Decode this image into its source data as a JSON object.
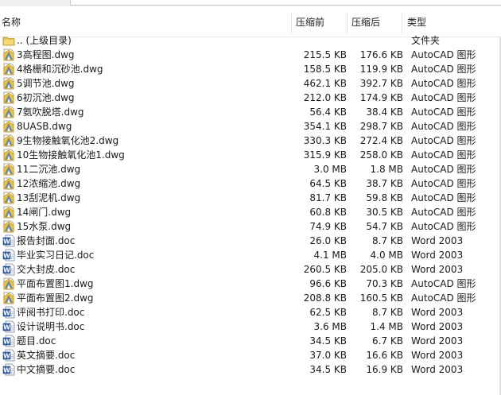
{
  "columns": {
    "name": "名称",
    "packed": "压缩前",
    "compressed": "压缩后",
    "type": "类型"
  },
  "files": [
    {
      "name": ".. (上级目录)",
      "packed": "",
      "compressed": "",
      "type": "文件夹",
      "icon": "folder-icon"
    },
    {
      "name": "3高程图.dwg",
      "packed": "215.5 KB",
      "compressed": "176.6 KB",
      "type": "AutoCAD 图形",
      "icon": "dwg-file-icon"
    },
    {
      "name": "4格栅和沉砂池.dwg",
      "packed": "158.5 KB",
      "compressed": "119.9 KB",
      "type": "AutoCAD 图形",
      "icon": "dwg-file-icon"
    },
    {
      "name": "5调节池.dwg",
      "packed": "462.1 KB",
      "compressed": "392.7 KB",
      "type": "AutoCAD 图形",
      "icon": "dwg-file-icon"
    },
    {
      "name": "6初沉池.dwg",
      "packed": "212.0 KB",
      "compressed": "174.9 KB",
      "type": "AutoCAD 图形",
      "icon": "dwg-file-icon"
    },
    {
      "name": "7氨吹脱塔.dwg",
      "packed": "56.4 KB",
      "compressed": "38.4 KB",
      "type": "AutoCAD 图形",
      "icon": "dwg-file-icon"
    },
    {
      "name": "8UASB.dwg",
      "packed": "354.1 KB",
      "compressed": "298.7 KB",
      "type": "AutoCAD 图形",
      "icon": "dwg-file-icon"
    },
    {
      "name": "9生物接触氧化池2.dwg",
      "packed": "330.3 KB",
      "compressed": "272.4 KB",
      "type": "AutoCAD 图形",
      "icon": "dwg-file-icon"
    },
    {
      "name": "10生物接触氧化池1.dwg",
      "packed": "315.9 KB",
      "compressed": "258.0 KB",
      "type": "AutoCAD 图形",
      "icon": "dwg-file-icon"
    },
    {
      "name": "11二沉池.dwg",
      "packed": "3.0 MB",
      "compressed": "1.8 MB",
      "type": "AutoCAD 图形",
      "icon": "dwg-file-icon"
    },
    {
      "name": "12浓缩池.dwg",
      "packed": "64.5 KB",
      "compressed": "38.7 KB",
      "type": "AutoCAD 图形",
      "icon": "dwg-file-icon"
    },
    {
      "name": "13刮泥机.dwg",
      "packed": "81.7 KB",
      "compressed": "59.8 KB",
      "type": "AutoCAD 图形",
      "icon": "dwg-file-icon"
    },
    {
      "name": "14闸门.dwg",
      "packed": "60.8 KB",
      "compressed": "30.5 KB",
      "type": "AutoCAD 图形",
      "icon": "dwg-file-icon"
    },
    {
      "name": "15水泵.dwg",
      "packed": "74.9 KB",
      "compressed": "54.7 KB",
      "type": "AutoCAD 图形",
      "icon": "dwg-file-icon"
    },
    {
      "name": "报告封面.doc",
      "packed": "26.0 KB",
      "compressed": "8.7 KB",
      "type": "Word 2003",
      "icon": "word-doc-icon"
    },
    {
      "name": "毕业实习日记.doc",
      "packed": "4.1 MB",
      "compressed": "4.0 MB",
      "type": "Word 2003",
      "icon": "word-doc-icon"
    },
    {
      "name": "交大封皮.doc",
      "packed": "260.5 KB",
      "compressed": "205.0 KB",
      "type": "Word 2003",
      "icon": "word-doc-icon"
    },
    {
      "name": "平面布置图1.dwg",
      "packed": "96.6 KB",
      "compressed": "70.3 KB",
      "type": "AutoCAD 图形",
      "icon": "dwg-file-icon"
    },
    {
      "name": "平面布置图2.dwg",
      "packed": "208.8 KB",
      "compressed": "160.5 KB",
      "type": "AutoCAD 图形",
      "icon": "dwg-file-icon"
    },
    {
      "name": "评阅书打印.doc",
      "packed": "62.5 KB",
      "compressed": "8.7 KB",
      "type": "Word 2003",
      "icon": "word-doc-icon"
    },
    {
      "name": "设计说明书.doc",
      "packed": "3.6 MB",
      "compressed": "1.4 MB",
      "type": "Word 2003",
      "icon": "word-doc-icon"
    },
    {
      "name": "题目.doc",
      "packed": "34.5 KB",
      "compressed": "6.7 KB",
      "type": "Word 2003",
      "icon": "word-doc-icon"
    },
    {
      "name": "英文摘要.doc",
      "packed": "37.0 KB",
      "compressed": "16.6 KB",
      "type": "Word 2003",
      "icon": "word-doc-icon"
    },
    {
      "name": "中文摘要.doc",
      "packed": "34.5 KB",
      "compressed": "16.9 KB",
      "type": "Word 2003",
      "icon": "word-doc-icon"
    }
  ]
}
